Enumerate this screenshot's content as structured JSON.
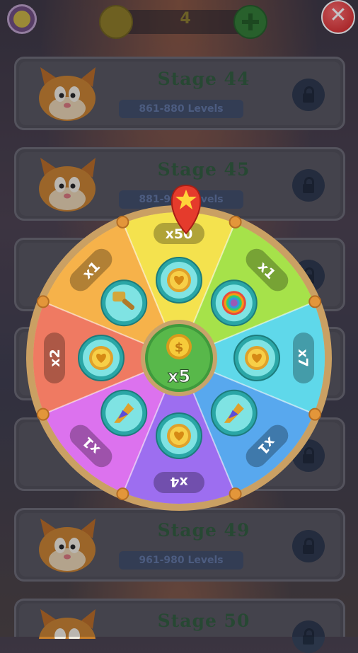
{
  "top_bar": {
    "coin_count": "4",
    "close_label": "✕"
  },
  "stages": [
    {
      "title": "Stage 44",
      "range": "861-880 Levels"
    },
    {
      "title": "Stage 45",
      "range": "881-900 Levels"
    },
    {
      "title": "Stage 49",
      "range": "961-980 Levels"
    },
    {
      "title": "Stage 50",
      "range": ""
    }
  ],
  "wheel": {
    "center_multiplier": "x5",
    "segments": [
      {
        "label": "x50",
        "color": "#f4e24e",
        "icon": "coin-spade-icon"
      },
      {
        "label": "x1",
        "color": "#a6e24a",
        "icon": "rainbow-bomb-icon"
      },
      {
        "label": "x7",
        "color": "#5fd8ea",
        "icon": "coin-heart-icon"
      },
      {
        "label": "x1",
        "color": "#58a8ee",
        "icon": "rocket-booster-icon"
      },
      {
        "label": "x4",
        "color": "#9d6ef0",
        "icon": "coin-heart-icon"
      },
      {
        "label": "x1",
        "color": "#dc72ee",
        "icon": "rocket-booster-icon"
      },
      {
        "label": "x2",
        "color": "#ef7a62",
        "icon": "coin-heart-icon"
      },
      {
        "label": "x1",
        "color": "#f6b24a",
        "icon": "hammer-icon"
      }
    ],
    "rim_color": "#e2bf84",
    "pointer_color": "#e53b2c"
  }
}
